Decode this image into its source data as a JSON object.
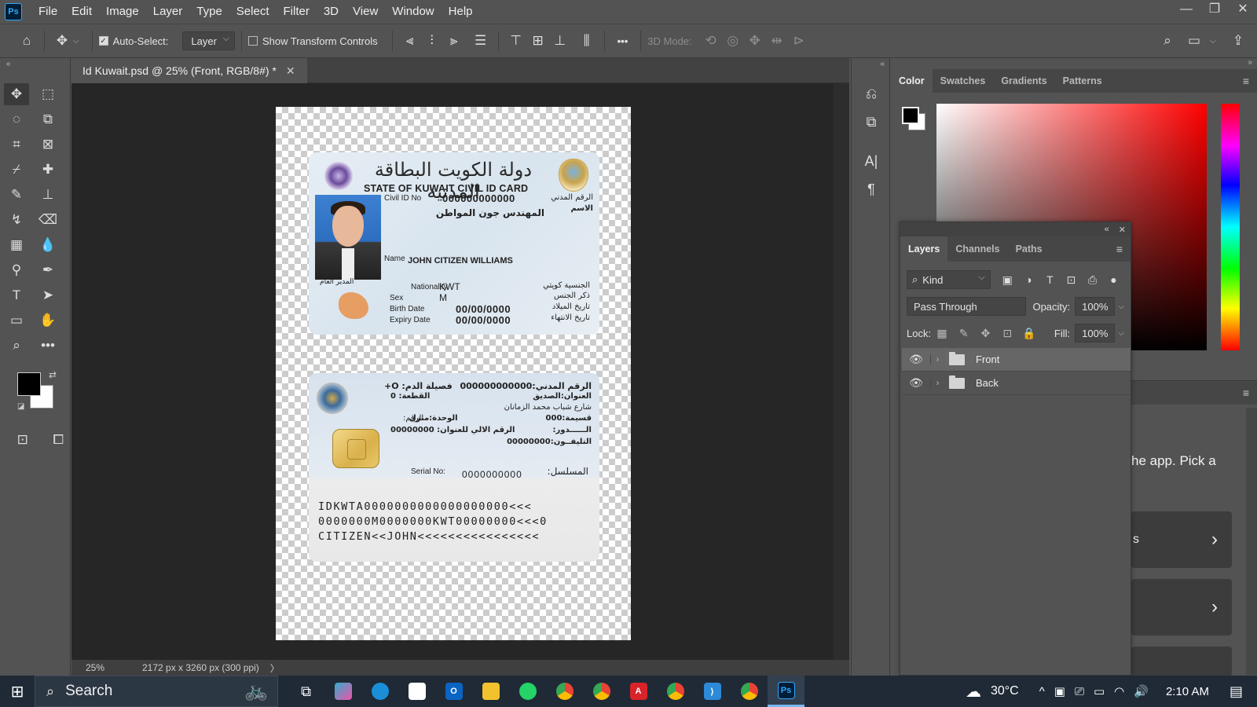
{
  "app": {
    "logo": "Ps"
  },
  "menu": [
    "File",
    "Edit",
    "Image",
    "Layer",
    "Type",
    "Select",
    "Filter",
    "3D",
    "View",
    "Window",
    "Help"
  ],
  "window_controls": {
    "minimize": "—",
    "restore": "❐",
    "close": "✕"
  },
  "options": {
    "auto_select_label": "Auto-Select:",
    "auto_select_checked": true,
    "auto_select_target": "Layer",
    "show_transform_label": "Show Transform Controls",
    "show_transform_checked": false,
    "mode_3d_label": "3D Mode:",
    "more": "•••"
  },
  "document": {
    "tab_title": "Id Kuwait.psd @ 25% (Front, RGB/8#) *",
    "zoom": "25%",
    "dimensions": "2172 px x 3260 px (300 ppi)",
    "status_arrow": "〉"
  },
  "card_front": {
    "arabic_title": "دولة الكويت البطاقة المدنية",
    "english_title": "STATE OF KUWAIT CIVIL ID CARD",
    "civil_id_label": "Civil ID No",
    "civil_id_value": "000000000000",
    "civil_id_label_ar": "الرقم المدني",
    "name_label_ar": "الاسم",
    "name_ar": "المهندس جون المواطن",
    "name_label": "Name",
    "name_value": "JOHN CITIZEN WILLIAMS",
    "director_ar": "المدير العام",
    "nationality_label": "Nationality",
    "nationality_value": "KWT",
    "nationality_ar": "الجنسية كويتي",
    "sex_label": "Sex",
    "sex_value": "M",
    "sex_ar": "ذكر الجنس",
    "birth_label": "Birth Date",
    "birth_value": "00/00/0000",
    "birth_ar": "تاريخ الميلاد",
    "expiry_label": "Expiry Date",
    "expiry_value": "00/00/0000",
    "expiry_ar": "تاريخ الانتهاء"
  },
  "card_back": {
    "blood_ar": "فصيلة الدم: O+",
    "civil_no_ar": "الرقم المدني:000000000000",
    "block_ar": "القطعة: 0",
    "address_ar": "العنوان:الصديق",
    "street_ar": "شارع شباب محمد الزمانان",
    "unit_ar": "الوحدة:منزل",
    "plot_ar": "قسيمة:000",
    "number_ar": "الرقم:",
    "auto_number_ar": "الرقم الالي للعنوان: 00000000",
    "floor_ar": "الــــــدور:",
    "phone_ar": "التليفــون:00000000",
    "serial_label": "Serial No:",
    "serial_value": "0000000000",
    "serial_ar": "المسلسل:",
    "mrz": [
      "IDKWTA0000000000000000000<<<",
      "0000000M0000000KWT00000000<<<0",
      "CITIZEN<<JOHN<<<<<<<<<<<<<<<<"
    ]
  },
  "color_panel": {
    "tabs": [
      "Color",
      "Swatches",
      "Gradients",
      "Patterns"
    ],
    "active_tab": "Color",
    "foreground": "#000000",
    "background": "#ffffff",
    "hue_color": "#ff0000"
  },
  "layers_panel": {
    "tabs": [
      "Layers",
      "Channels",
      "Paths"
    ],
    "active_tab": "Layers",
    "filter_kind": "Kind",
    "blend_mode": "Pass Through",
    "opacity_label": "Opacity:",
    "opacity_value": "100%",
    "lock_label": "Lock:",
    "fill_label": "Fill:",
    "fill_value": "100%",
    "layers": [
      {
        "name": "Front",
        "type": "group",
        "visible": true,
        "selected": true
      },
      {
        "name": "Back",
        "type": "group",
        "visible": true,
        "selected": false
      }
    ]
  },
  "learn_panel": {
    "text": "he app. Pick a",
    "item1": "s"
  },
  "taskbar": {
    "search_placeholder": "Search",
    "weather": "30°C",
    "time": "2:10 AM",
    "apps": [
      "task-view",
      "copilot",
      "edge",
      "store",
      "outlook",
      "file-explorer",
      "whatsapp",
      "chrome",
      "chrome-2",
      "acrobat",
      "chrome-3",
      "vscode",
      "chrome-4",
      "photoshop"
    ]
  }
}
